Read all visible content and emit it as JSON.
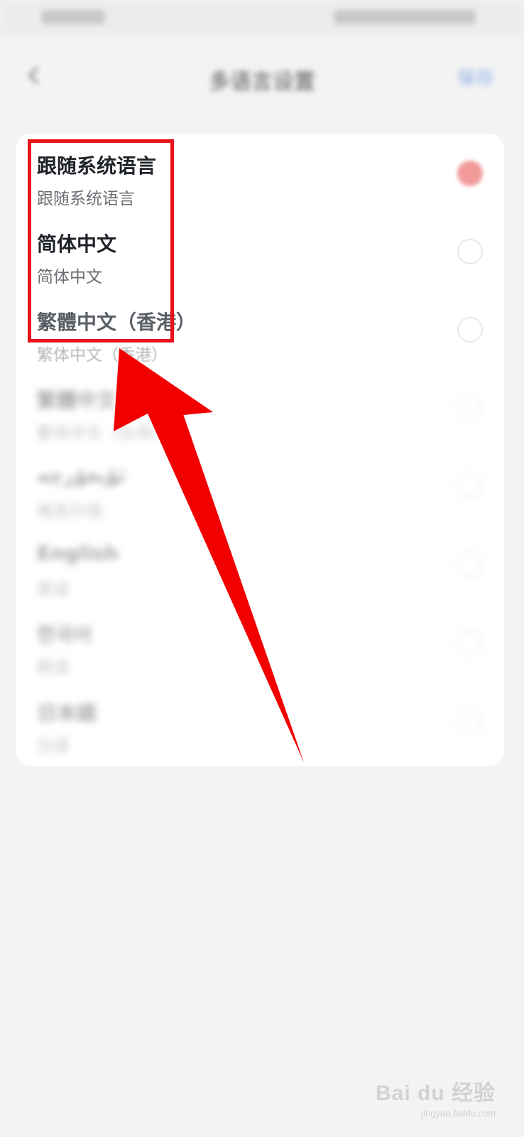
{
  "header": {
    "title": "多语言设置",
    "action_label": "保存"
  },
  "languages": [
    {
      "title": "跟随系统语言",
      "subtitle": "跟随系统语言",
      "selected": true
    },
    {
      "title": "简体中文",
      "subtitle": "简体中文",
      "selected": false
    },
    {
      "title": "繁體中文（香港）",
      "subtitle": "繁体中文（香港）",
      "selected": false
    },
    {
      "title": "繁體中文（台灣）",
      "subtitle": "繁体中文（台湾）",
      "selected": false
    },
    {
      "title": "ئۇيغۇرچە",
      "subtitle": "维吾尔语",
      "selected": false
    },
    {
      "title": "English",
      "subtitle": "英语",
      "selected": false
    },
    {
      "title": "한국어",
      "subtitle": "韩语",
      "selected": false
    },
    {
      "title": "日本語",
      "subtitle": "日语",
      "selected": false
    }
  ],
  "watermark": {
    "logo": "Bai du 经验",
    "url": "jingyan.baidu.com"
  },
  "colors": {
    "highlight": "#e8121a",
    "arrow": "#f20000",
    "selected_radio": "#f29a9a"
  }
}
